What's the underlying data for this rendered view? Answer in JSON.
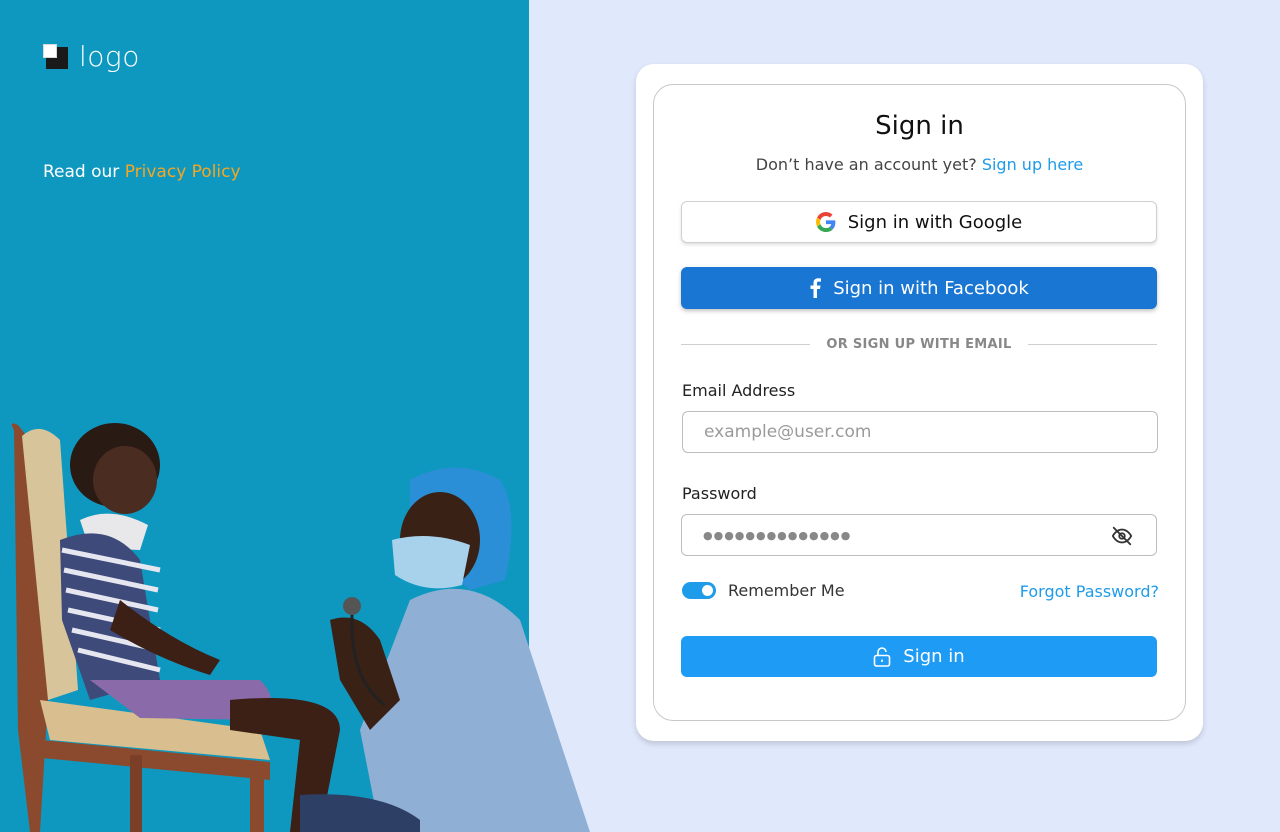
{
  "brand": {
    "logo_text": "logo"
  },
  "left": {
    "privacy_prefix": "Read our ",
    "privacy_link": "Privacy Policy"
  },
  "card": {
    "title": "Sign in",
    "subtitle_prefix": "Don’t have an account yet? ",
    "signup_link": "Sign up here",
    "google_button": "Sign in with Google",
    "facebook_button": "Sign in with Facebook",
    "divider_text": "OR SIGN UP WITH EMAIL",
    "email_label": "Email Address",
    "email_placeholder": "example@user.com",
    "password_label": "Password",
    "password_value": "●●●●●●●●●●●●●●",
    "remember_label": "Remember Me",
    "remember_checked": true,
    "forgot_link": "Forgot Password?",
    "signin_button": "Sign in"
  },
  "colors": {
    "left_panel": "#0f98bf",
    "right_bg": "#e0e8fc",
    "accent": "#1e9be9",
    "facebook": "#1976d2",
    "privacy_link": "#f5a623"
  },
  "icons": [
    "google-icon",
    "facebook-icon",
    "eye-off-icon",
    "lock-open-icon"
  ]
}
